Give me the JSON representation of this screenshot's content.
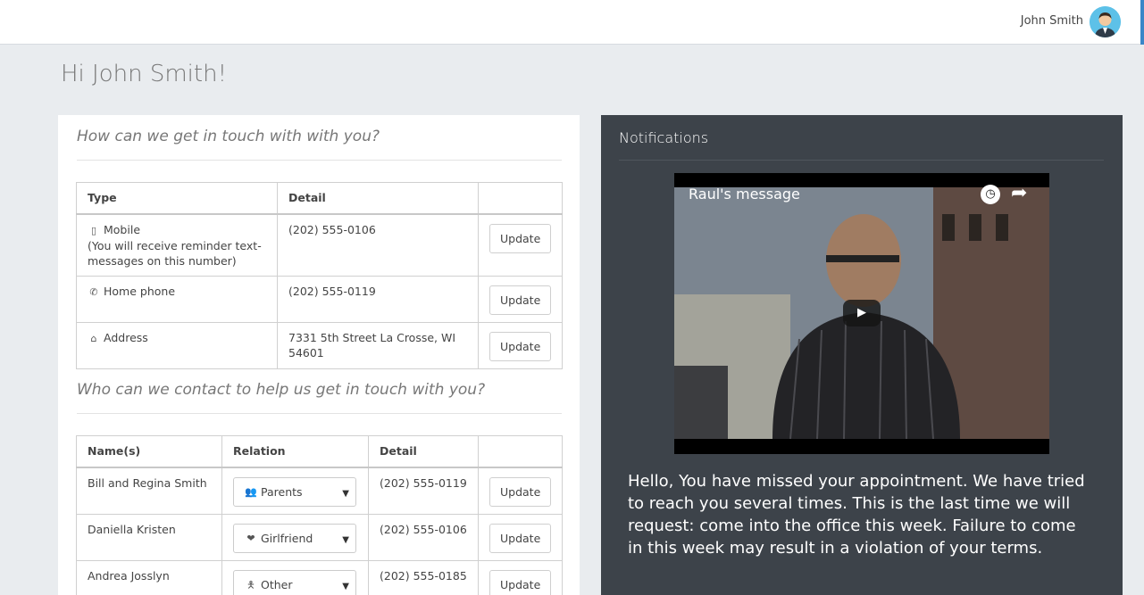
{
  "header": {
    "user_name": "John Smith",
    "avatar_icon": "user-avatar-icon"
  },
  "greeting": "Hi John Smith!",
  "contact_section": {
    "title": "How can we get in touch with with you?",
    "columns": [
      "Type",
      "Detail",
      ""
    ],
    "rows": [
      {
        "icon": "mobile-phone-icon",
        "type": "Mobile",
        "note": "(You will receive reminder text-messages on this number)",
        "detail": "(202) 555-0106",
        "action": "Update"
      },
      {
        "icon": "phone-icon",
        "type": "Home phone",
        "detail": "(202) 555-0119",
        "action": "Update"
      },
      {
        "icon": "home-icon",
        "type": "Address",
        "detail": "7331 5th Street La Crosse, WI 54601",
        "action": "Update"
      }
    ]
  },
  "helpers_section": {
    "title": "Who can we contact to help us get in touch with you?",
    "columns": [
      "Name(s)",
      "Relation",
      "Detail",
      ""
    ],
    "rows": [
      {
        "name": "Bill and Regina Smith",
        "relation_icon": "group-icon",
        "relation": "Parents",
        "detail": "(202) 555-0119",
        "action": "Update"
      },
      {
        "name": "Daniella Kristen",
        "relation_icon": "heart-icon",
        "relation": "Girlfriend",
        "detail": "(202) 555-0106",
        "action": "Update"
      },
      {
        "name": "Andrea Josslyn",
        "relation_icon": "person-icon",
        "relation": "Other",
        "detail": "(202) 555-0185",
        "action": "Update"
      }
    ]
  },
  "notifications": {
    "title": "Notifications",
    "video": {
      "title": "Raul's message",
      "play_icon": "play-icon",
      "watch_later_icon": "clock-icon",
      "share_icon": "share-icon"
    },
    "message": "Hello, You have missed your appointment. We have tried to reach you several times. This is the last time we will request: come into the office this week. Failure to come in this week may result in a violation of your terms."
  },
  "colors": {
    "page_bg": "#e9ecef",
    "notifications_bg": "#3d434a",
    "avatar_bg": "#5dc1e8"
  }
}
